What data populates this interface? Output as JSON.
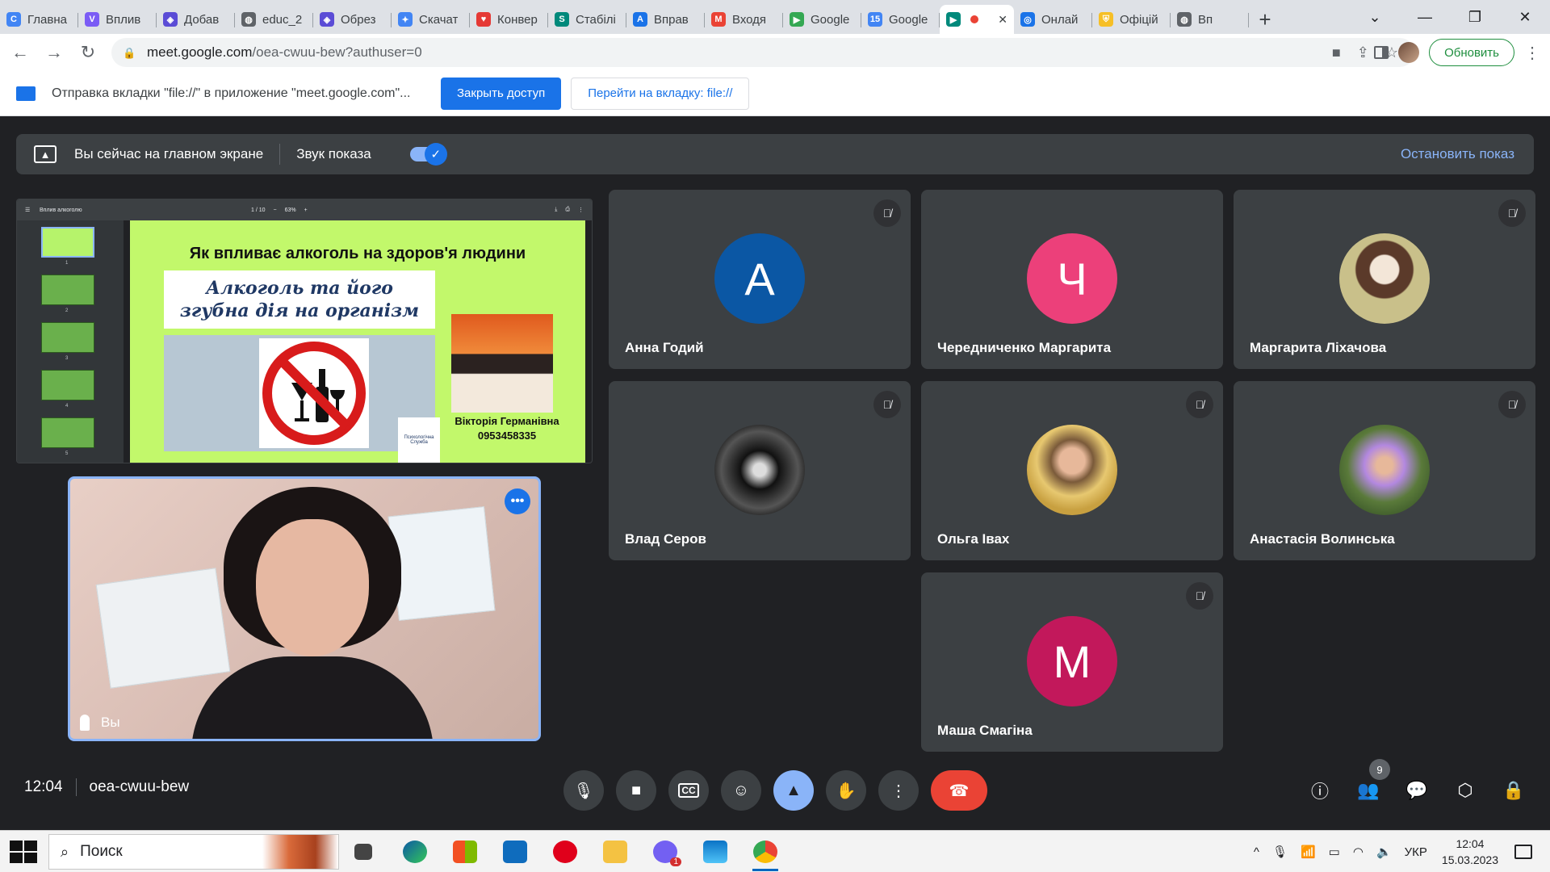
{
  "browser": {
    "tabs": [
      {
        "label": "Главна",
        "fav_color": "#4285f4",
        "fav": "C"
      },
      {
        "label": "Вплив",
        "fav_color": "#7b5cf5",
        "fav": "V"
      },
      {
        "label": "Добав",
        "fav_color": "#5b4cd6",
        "fav": "◈"
      },
      {
        "label": "educ_2",
        "fav_color": "#5f6368",
        "fav": "◍"
      },
      {
        "label": "Обрез",
        "fav_color": "#5b4cd6",
        "fav": "◈"
      },
      {
        "label": "Скачат",
        "fav_color": "#4285f4",
        "fav": "✦"
      },
      {
        "label": "Конвер",
        "fav_color": "#e53935",
        "fav": "♥"
      },
      {
        "label": "Стабілі",
        "fav_color": "#00897b",
        "fav": "S"
      },
      {
        "label": "Вправ",
        "fav_color": "#1a73e8",
        "fav": "A"
      },
      {
        "label": "Входя",
        "fav_color": "#ea4335",
        "fav": "M"
      },
      {
        "label": "Google",
        "fav_color": "#34a853",
        "fav": "▶"
      },
      {
        "label": "Google",
        "fav_color": "#4285f4",
        "fav": "15"
      },
      {
        "label": "",
        "fav_color": "#00897b",
        "fav": "▶",
        "active": true
      },
      {
        "label": "Онлай",
        "fav_color": "#1a73e8",
        "fav": "◎"
      },
      {
        "label": "Офіцій",
        "fav_color": "#f6bf26",
        "fav": "⛨"
      },
      {
        "label": "Вп",
        "fav_color": "#5f6368",
        "fav": "◍"
      }
    ],
    "new_tab": "+",
    "url_host": "meet.google.com",
    "url_path": "/oea-cwuu-bew?authuser=0",
    "update_label": "Обновить"
  },
  "infobar": {
    "text": "Отправка вкладки \"file://\" в приложение \"meet.google.com\"...",
    "primary": "Закрыть доступ",
    "secondary": "Перейти на вкладку: file://"
  },
  "presenting": {
    "text": "Вы сейчас на главном экране",
    "audio_label": "Звук показа",
    "audio_on": true,
    "stop_label": "Остановить показ"
  },
  "presentation": {
    "doc_title": "Вплив алкоголю",
    "page": "1 / 10",
    "zoom": "63%",
    "thumb_numbers": [
      "1",
      "2",
      "3",
      "4",
      "5"
    ],
    "slide_title": "Як впливає алкоголь на здоров'я людини",
    "box_line1": "Алкоголь та його",
    "box_line2": "згубна дія на організм",
    "logo_text": "Психологічна Служба",
    "author_name": "Вікторія Германівна",
    "author_phone": "0953458335"
  },
  "self_view": {
    "name": "Вы",
    "more": "•••"
  },
  "participants": [
    {
      "name": "Анна Годий",
      "initial": "А",
      "color": "#0b57a4",
      "muted": true
    },
    {
      "name": "Чередниченко Маргарита",
      "initial": "Ч",
      "color": "#ec407a",
      "muted": false
    },
    {
      "name": "Маргарита Ліхачова",
      "initial": "",
      "photo": "photo",
      "muted": true
    },
    {
      "name": "Влад Серов",
      "initial": "",
      "photo": "photo",
      "muted": true
    },
    {
      "name": "Ольга Івах",
      "initial": "",
      "photo": "photo",
      "muted": true
    },
    {
      "name": "Анастасія Волинська",
      "initial": "",
      "photo": "photo",
      "muted": true
    },
    {
      "name": "Маша Смагіна",
      "initial": "М",
      "color": "#c2185b",
      "muted": true
    }
  ],
  "meeting": {
    "time": "12:04",
    "code": "oea-cwuu-bew",
    "people_count": "9"
  },
  "taskbar": {
    "search": "Поиск",
    "lang": "УКР",
    "time": "12:04",
    "date": "15.03.2023",
    "viber_badge": "1"
  },
  "colors": {
    "accent": "#1a73e8",
    "hangup": "#ea4335",
    "present_active": "#8ab4f8",
    "meet_bg": "#202124",
    "tile_bg": "#3c4043"
  }
}
